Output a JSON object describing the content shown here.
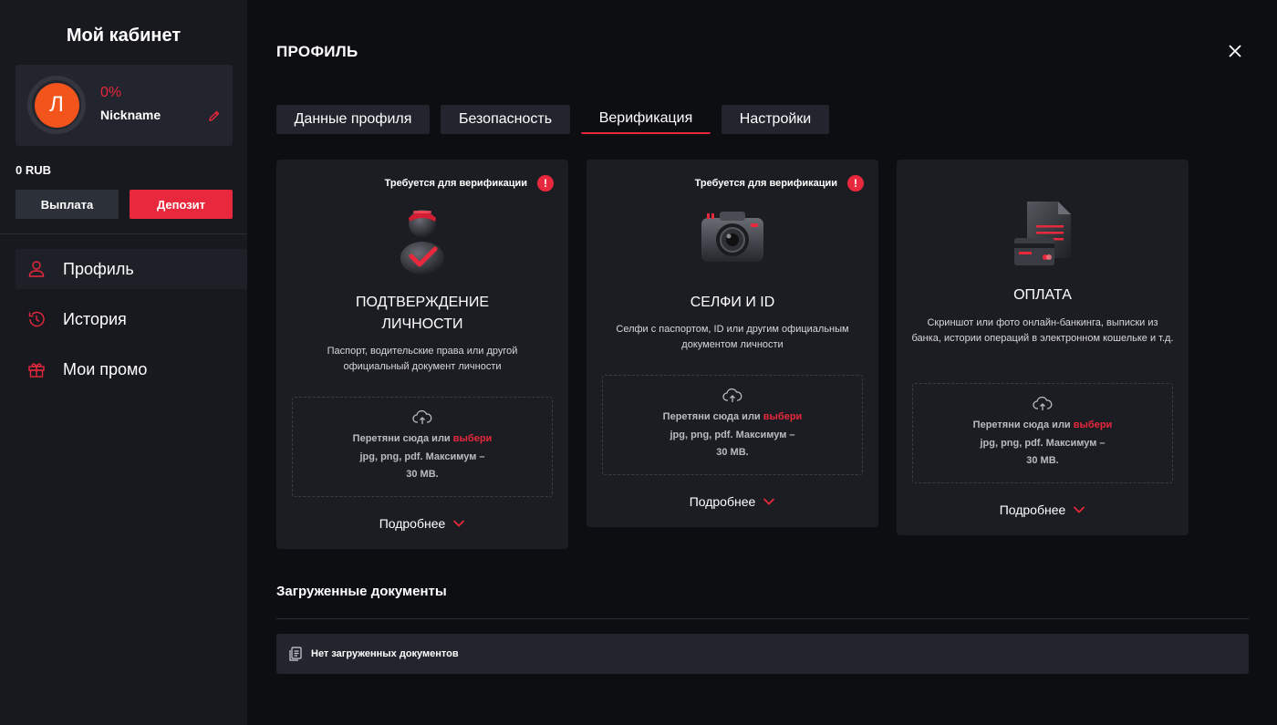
{
  "sidebar": {
    "title": "Мой кабинет",
    "avatar_letter": "Л",
    "progress": "0%",
    "nickname": "Nickname",
    "balance": "0 RUB",
    "payout_label": "Выплата",
    "deposit_label": "Депозит",
    "nav": [
      {
        "label": "Профиль",
        "icon": "user-icon",
        "active": true
      },
      {
        "label": "История",
        "icon": "history-icon",
        "active": false
      },
      {
        "label": "Мои промо",
        "icon": "gift-icon",
        "active": false
      }
    ]
  },
  "main": {
    "title": "ПРОФИЛЬ",
    "tabs": [
      {
        "label": "Данные профиля",
        "active": false
      },
      {
        "label": "Безопасность",
        "active": false
      },
      {
        "label": "Верификация",
        "active": true
      },
      {
        "label": "Настройки",
        "active": false
      }
    ],
    "cards": [
      {
        "required": "Требуется для верификации",
        "icon": "person-check-icon",
        "title_line1": "ПОДТВЕРЖДЕНИЕ",
        "title_line2": "ЛИЧНОСТИ",
        "desc": "Паспорт, водительские права или другой официальный документ личности",
        "drop_text": "Перетяни сюда или",
        "drop_pick": "выбери",
        "drop_formats": "jpg, png, pdf. Максимум –",
        "drop_max": "30 MB.",
        "more": "Подробнее"
      },
      {
        "required": "Требуется для верификации",
        "icon": "camera-icon",
        "title_line1": "СЕЛФИ И ID",
        "desc": "Селфи с паспортом, ID или другим официальным документом личности",
        "drop_text": "Перетяни сюда или",
        "drop_pick": "выбери",
        "drop_formats": "jpg, png, pdf. Максимум –",
        "drop_max": "30 MB.",
        "more": "Подробнее"
      },
      {
        "icon": "payment-document-icon",
        "title_line1": "ОПЛАТА",
        "desc": "Скриншот или фото онлайн-банкинга, выписки из банка, истории операций в электронном кошельке и т.д.",
        "drop_text": "Перетяни сюда или",
        "drop_pick": "выбери",
        "drop_formats": "jpg, png, pdf. Максимум –",
        "drop_max": "30 MB.",
        "more": "Подробнее"
      }
    ],
    "docs_title": "Загруженные документы",
    "docs_empty": "Нет загруженных документов"
  },
  "colors": {
    "accent": "#e8283c",
    "avatar": "#f2541b",
    "sidebar_bg": "#17191f",
    "card_bg": "#1b1d23"
  }
}
